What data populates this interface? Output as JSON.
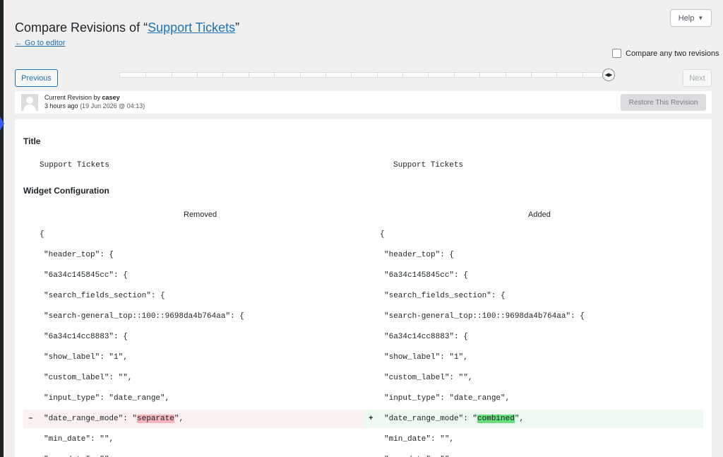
{
  "header": {
    "title_prefix": "Compare Revisions of “",
    "title_link": "Support Tickets",
    "title_suffix": "”",
    "go_to_editor": "← Go to editor",
    "help_label": "Help",
    "compare_two_label": "Compare any two revisions"
  },
  "navigation": {
    "previous_label": "Previous",
    "next_label": "Next",
    "slider_position": 1.0
  },
  "revision_meta": {
    "by_prefix": "Current Revision by ",
    "author": "casey",
    "time_ago": "3 hours ago",
    "date": "(19 Jun 2026 @ 04:13)",
    "restore_label": "Restore This Revision"
  },
  "diff": {
    "title_section": {
      "heading": "Title",
      "left_value": "Support Tickets",
      "right_value": "Support Tickets"
    },
    "widget_section": {
      "heading": "Widget Configuration",
      "removed_label": "Removed",
      "added_label": "Added",
      "lines": [
        {
          "left": "{",
          "right": "{",
          "indent": 0
        },
        {
          "left": "\"header_top\": {",
          "right": "\"header_top\": {",
          "indent": 1
        },
        {
          "left": "\"6a34c145845cc\": {",
          "right": "\"6a34c145845cc\": {",
          "indent": 1
        },
        {
          "left": "\"search_fields_section\": {",
          "right": "\"search_fields_section\": {",
          "indent": 1
        },
        {
          "left": "\"search-general_top::100::9698da4b764aa\": {",
          "right": "\"search-general_top::100::9698da4b764aa\": {",
          "indent": 1
        },
        {
          "left": "\"6a34c14cc8883\": {",
          "right": "\"6a34c14cc8883\": {",
          "indent": 1
        },
        {
          "left": "\"show_label\": \"1\",",
          "right": "\"show_label\": \"1\",",
          "indent": 1
        },
        {
          "left": "\"custom_label\": \"\",",
          "right": "\"custom_label\": \"\",",
          "indent": 1
        },
        {
          "left": "\"input_type\": \"date_range\",",
          "right": "\"input_type\": \"date_range\",",
          "indent": 1
        },
        {
          "changed": true,
          "indent": 1,
          "left_sign": "–",
          "right_sign": "+",
          "left_pre": "\"date_range_mode\": \"",
          "left_hl": "separate",
          "left_post": "\",",
          "right_pre": "\"date_range_mode\": \"",
          "right_hl": "combined",
          "right_post": "\","
        },
        {
          "left": "\"min_date\": \"\",",
          "right": "\"min_date\": \"\",",
          "indent": 1
        },
        {
          "left": "\"max_date\": \"\",",
          "right": "\"max_date\": \"\",",
          "indent": 1
        }
      ]
    }
  }
}
